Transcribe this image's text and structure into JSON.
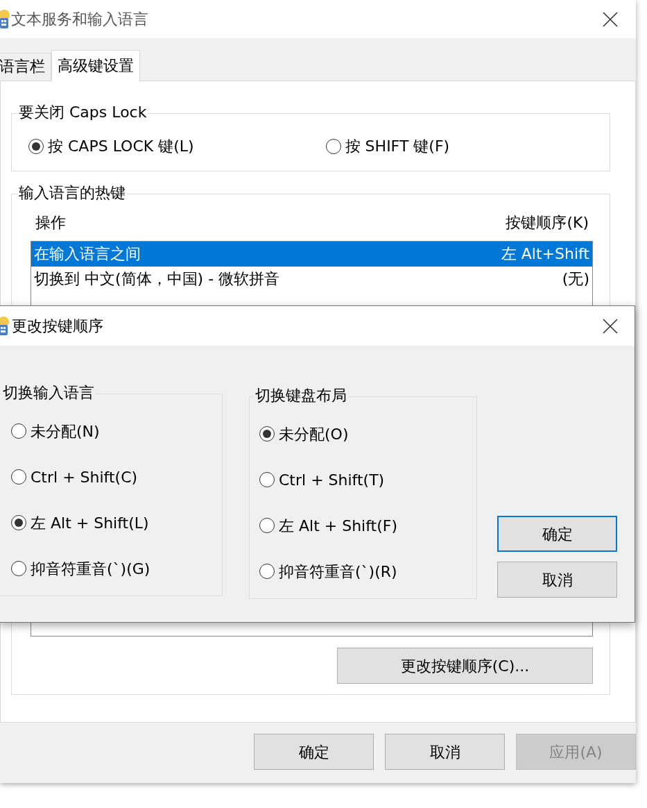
{
  "window": {
    "title": "文本服务和输入语言"
  },
  "tabs": [
    {
      "label": "语言栏",
      "selected": false
    },
    {
      "label": "高级键设置",
      "selected": true
    }
  ],
  "caps_lock_group": {
    "title": "要关闭 Caps Lock",
    "options": [
      {
        "label": "按 CAPS LOCK 键(L)",
        "selected": true
      },
      {
        "label": "按 SHIFT 键(F)",
        "selected": false
      }
    ]
  },
  "hotkeys_group": {
    "title": "输入语言的热键",
    "columns": [
      "操作",
      "按键顺序(K)"
    ],
    "rows": [
      {
        "action": "在输入语言之间",
        "keys": "左 Alt+Shift",
        "selected": true
      },
      {
        "action": "切换到 中文(简体，中国) - 微软拼音",
        "keys": "(无)",
        "selected": false
      }
    ],
    "change_button": "更改按键顺序(C)..."
  },
  "buttons": [
    {
      "label": "确定",
      "disabled": false
    },
    {
      "label": "取消",
      "disabled": false
    },
    {
      "label": "应用(A)",
      "disabled": true
    }
  ],
  "dialog": {
    "title": "更改按键顺序",
    "groups": [
      {
        "title": "切换输入语言",
        "options": [
          {
            "label": "未分配(N)",
            "selected": false
          },
          {
            "label": "Ctrl + Shift(C)",
            "selected": false
          },
          {
            "label": "左 Alt + Shift(L)",
            "selected": true
          },
          {
            "label": "抑音符重音(`)(G)",
            "selected": false
          }
        ]
      },
      {
        "title": "切换键盘布局",
        "options": [
          {
            "label": "未分配(O)",
            "selected": true
          },
          {
            "label": "Ctrl + Shift(T)",
            "selected": false
          },
          {
            "label": "左 Alt + Shift(F)",
            "selected": false
          },
          {
            "label": "抑音符重音(`)(R)",
            "selected": false
          }
        ]
      }
    ],
    "buttons": [
      {
        "label": "确定",
        "focused": true
      },
      {
        "label": "取消",
        "focused": false
      }
    ]
  }
}
